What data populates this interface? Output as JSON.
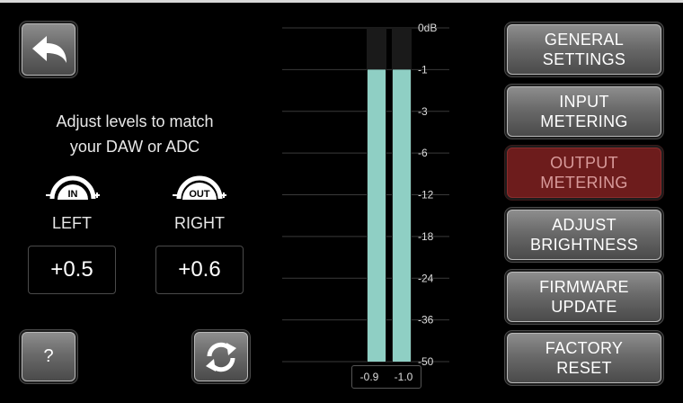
{
  "instructions": {
    "line1": "Adjust levels to match",
    "line2": "your DAW or ADC"
  },
  "knobs": {
    "in_label": "IN",
    "out_label": "OUT"
  },
  "channels": {
    "left": {
      "label": "LEFT",
      "value": "+0.5"
    },
    "right": {
      "label": "RIGHT",
      "value": "+0.6"
    }
  },
  "buttons": {
    "help_label": "?"
  },
  "icons": {
    "back": "back-arrow-icon",
    "refresh": "refresh-icon"
  },
  "meter": {
    "scale_labels": [
      "0dB",
      "-1",
      "-3",
      "-6",
      "-12",
      "-18",
      "-24",
      "-36",
      "-50"
    ],
    "left_level_db": -1,
    "right_level_db": -1,
    "left_peak": "-0.9",
    "right_peak": "-1.0",
    "bar_color": "#8fcfc4"
  },
  "menu": {
    "general": {
      "line1": "GENERAL",
      "line2": "SETTINGS"
    },
    "input": {
      "line1": "INPUT",
      "line2": "METERING"
    },
    "output": {
      "line1": "OUTPUT",
      "line2": "METERING"
    },
    "brightness": {
      "line1": "ADJUST",
      "line2": "BRIGHTNESS"
    },
    "firmware": {
      "line1": "FIRMWARE",
      "line2": "UPDATE"
    },
    "factory": {
      "line1": "FACTORY",
      "line2": "RESET"
    }
  },
  "colors": {
    "active_button": "#6d1c1c",
    "active_text": "#d89a9a"
  }
}
